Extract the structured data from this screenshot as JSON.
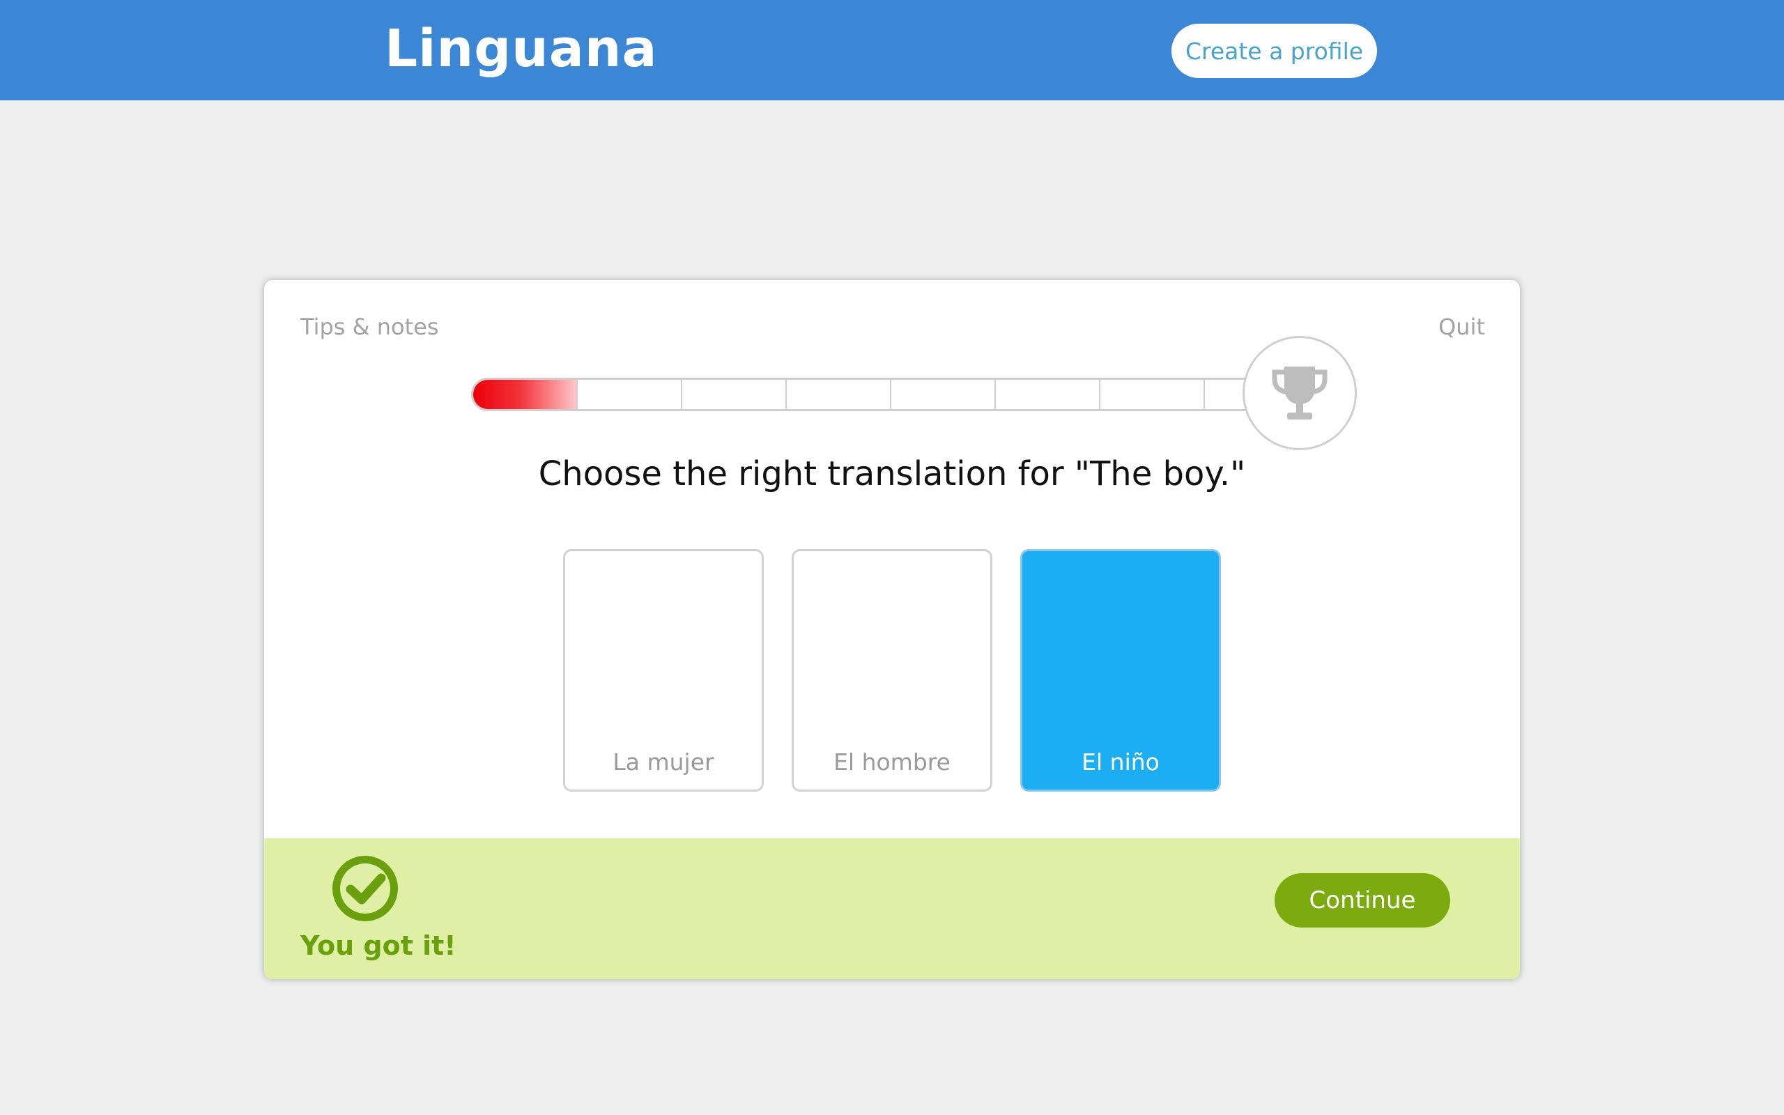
{
  "app": {
    "logo": "Linguana",
    "create_profile_label": "Create a profile",
    "brand_color": "#3b87d5"
  },
  "lesson": {
    "tips_label": "Tips & notes",
    "quit_label": "Quit",
    "progress": {
      "filled_segments": 1,
      "total_segments": 8
    },
    "goal_icon": "trophy-icon",
    "question": "Choose the right translation for \"The boy.\"",
    "choices": [
      {
        "label": "La mujer",
        "selected": false
      },
      {
        "label": "El hombre",
        "selected": false
      },
      {
        "label": "El niño",
        "selected": true
      }
    ],
    "selected_color": "#1cadf3"
  },
  "feedback": {
    "status_icon": "check-circle-icon",
    "message": "You got it!",
    "continue_label": "Continue",
    "color": "#6a9f0e",
    "background": "#dff0a6"
  }
}
